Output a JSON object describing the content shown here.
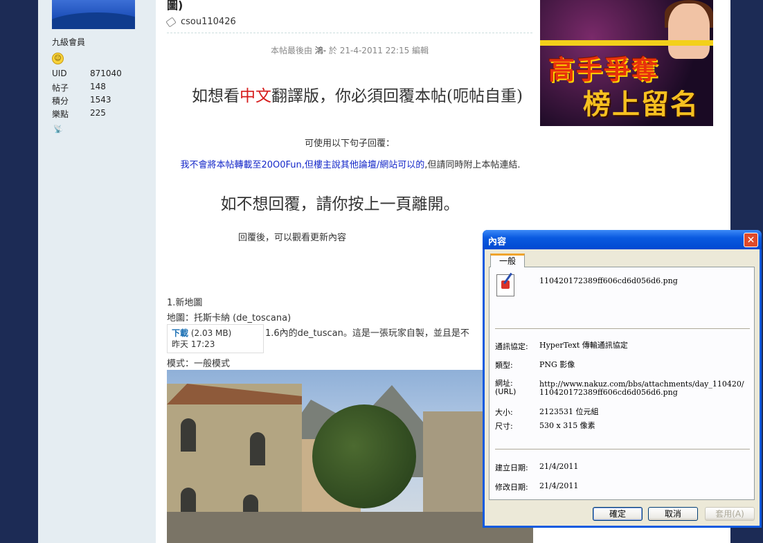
{
  "sidebar": {
    "rank": "九級會員",
    "stats": [
      {
        "k": "UID",
        "v": "871040"
      },
      {
        "k": "帖子",
        "v": "148"
      },
      {
        "k": "積分",
        "v": "1543"
      },
      {
        "k": "樂點",
        "v": "225"
      }
    ]
  },
  "post": {
    "title_tail": "圖)",
    "tag": "csou110426",
    "edited": {
      "prefix": "本帖最後由 ",
      "who": "鴻-",
      "suffix": " 於 21-4-2011 22:15 編輯"
    },
    "headline": {
      "a": "如想看",
      "b": "中文",
      "c": "翻譯版，你必須回覆本帖(",
      "d": "呃帖自重)"
    },
    "instruction": "可使用以下句子回覆：",
    "reply_sentence": {
      "blue": "我不會將本帖轉載至20O0Fun,但樓主說其他論壇/網站可以的",
      "rest": ",但請同時附上本帖連結."
    },
    "leave_line": "如不想回覆，請你按上一頁離開。",
    "after_reply": "回覆後，可以觀看更新內容",
    "map_number": "1.新地圖",
    "map_name": "地圖：托斯卡納 (de_toscana)",
    "map_desc": "1.6內的de_tuscan。這是一張玩家自製，並且是不",
    "mode": "模式：一般模式"
  },
  "attachment_tooltip": {
    "download": "下載",
    "size": "(2.03 MB)",
    "time": "昨天 17:23"
  },
  "ad": {
    "line1": "高手爭奪",
    "line2": "榜上留名"
  },
  "dialog": {
    "title": "內容",
    "close": "✕",
    "tab": "一般",
    "filename": "110420172389ff606cd6d056d6.png",
    "fields": {
      "protocol_label": "通訊協定:",
      "protocol_value": "HyperText 傳輸通訊協定",
      "type_label": "類型:",
      "type_value": "PNG 影像",
      "url_label": "網址:",
      "url_label2": "(URL)",
      "url_value": "http://www.nakuz.com/bbs/attachments/day_110420/110420172389ff606cd6d056d6.png",
      "size_label": "大小:",
      "size_value": "2123531 位元組",
      "dims_label": "尺寸:",
      "dims_value": "530 x 315 像素",
      "created_label": "建立日期:",
      "created_value": "21/4/2011",
      "modified_label": "修改日期:",
      "modified_value": "21/4/2011"
    },
    "buttons": {
      "ok": "確定",
      "cancel": "取消",
      "apply": "套用(A)"
    }
  }
}
